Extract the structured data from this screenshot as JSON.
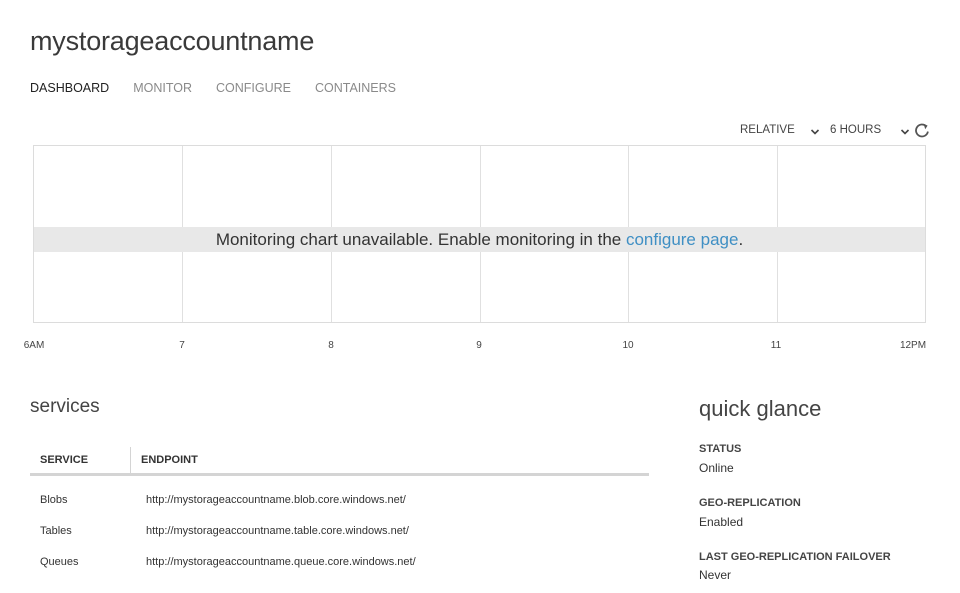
{
  "header": {
    "title": "mystorageaccountname"
  },
  "tabs": [
    {
      "label": "DASHBOARD",
      "active": true
    },
    {
      "label": "MONITOR",
      "active": false
    },
    {
      "label": "CONFIGURE",
      "active": false
    },
    {
      "label": "CONTAINERS",
      "active": false
    }
  ],
  "chart_controls": {
    "mode": "RELATIVE",
    "range": "6 HOURS",
    "dropdown_icon": "chevron-down-icon",
    "refresh_icon": "refresh-icon"
  },
  "chart": {
    "message": "Monitoring chart unavailable. Enable monitoring in the ",
    "link": "configure page",
    "message_end": ".",
    "link_color": "#3f8fc4",
    "banner_color": "#e8e8e8"
  },
  "chart_data": {
    "type": "line",
    "categories": [
      "6AM",
      "7",
      "8",
      "9",
      "10",
      "11",
      "12PM"
    ],
    "series": [],
    "title": "",
    "xlabel": "",
    "ylabel": "",
    "grid": true
  },
  "services": {
    "title": "services",
    "columns": [
      "SERVICE",
      "ENDPOINT"
    ],
    "rows": [
      {
        "service": "Blobs",
        "endpoint": "http://mystorageaccountname.blob.core.windows.net/"
      },
      {
        "service": "Tables",
        "endpoint": "http://mystorageaccountname.table.core.windows.net/"
      },
      {
        "service": "Queues",
        "endpoint": "http://mystorageaccountname.queue.core.windows.net/"
      }
    ]
  },
  "quick_glance": {
    "title": "quick glance",
    "items": [
      {
        "label": "STATUS",
        "value": "Online"
      },
      {
        "label": "GEO-REPLICATION",
        "value": "Enabled"
      },
      {
        "label": "LAST GEO-REPLICATION FAILOVER",
        "value": "Never"
      }
    ]
  }
}
